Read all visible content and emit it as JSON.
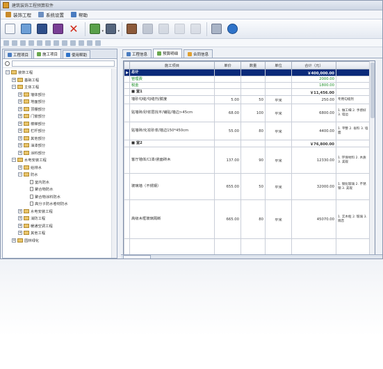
{
  "window": {
    "title": "建筑装饰工程预算软件",
    "icon_color": "#d99a2b"
  },
  "menu": [
    {
      "label": "装饰工程",
      "icon": "building-icon"
    },
    {
      "label": "系统设置",
      "icon": "settings-icon"
    },
    {
      "label": "帮助",
      "icon": "help-icon"
    }
  ],
  "toolbar": {
    "buttons": [
      {
        "name": "new-document-icon",
        "color": "#f4f6fa",
        "border": "#8894a8"
      },
      {
        "name": "open-folder-icon",
        "color": "#6d9fd6",
        "border": "#2f5e96"
      },
      {
        "name": "save-icon",
        "color": "#2f4f8a",
        "border": "#1b3260"
      },
      {
        "name": "save-as-icon",
        "color": "#7a3f95",
        "border": "#4c2260"
      },
      {
        "name": "delete-icon",
        "color": "#d12a1a",
        "border": "#8c1309"
      },
      {
        "name": "export-icon",
        "color": "#5aa04a",
        "border": "#356b28"
      },
      {
        "name": "print-icon",
        "color": "#55657d",
        "border": "#303c50"
      },
      {
        "name": "user-icon",
        "color": "#8c5a3a",
        "border": "#553520"
      },
      {
        "name": "settings-icon",
        "color": "#8a95a8",
        "border": "#55607a"
      },
      {
        "name": "calculator-icon",
        "color": "#b7bfcc",
        "border": "#7f8898"
      },
      {
        "name": "report-icon",
        "color": "#c9ced8",
        "border": "#8f97a6"
      },
      {
        "name": "table-icon",
        "color": "#c2c8d3",
        "border": "#888f9d"
      },
      {
        "name": "grid-icon",
        "color": "#a9b4c6",
        "border": "#6d7890"
      },
      {
        "name": "info-icon",
        "color": "#2f73c9",
        "border": "#1a4b8a"
      }
    ]
  },
  "left_panel": {
    "tabs": [
      {
        "label": "工程项目",
        "icon_color": "#4a7cc0"
      },
      {
        "label": "施工项目",
        "icon_color": "#6aa84f"
      },
      {
        "label": "使用帮助",
        "icon_color": "#2f73c9"
      }
    ],
    "search_placeholder": "",
    "tree": [
      {
        "label": "装饰工程",
        "level": 0,
        "type": "folder",
        "expander": "−"
      },
      {
        "label": "基础工程",
        "level": 1,
        "type": "folder",
        "expander": "+"
      },
      {
        "label": "主体工程",
        "level": 1,
        "type": "folder",
        "expander": "−"
      },
      {
        "label": "墙体部分",
        "level": 2,
        "type": "folder",
        "expander": "+"
      },
      {
        "label": "地面部分",
        "level": 2,
        "type": "folder",
        "expander": "+"
      },
      {
        "label": "顶棚部分",
        "level": 2,
        "type": "folder",
        "expander": "+"
      },
      {
        "label": "门窗部分",
        "level": 2,
        "type": "folder",
        "expander": "+"
      },
      {
        "label": "楼梯部分",
        "level": 2,
        "type": "folder",
        "expander": "+"
      },
      {
        "label": "栏杆部分",
        "level": 2,
        "type": "folder",
        "expander": "+"
      },
      {
        "label": "其他部分",
        "level": 2,
        "type": "folder",
        "expander": "+"
      },
      {
        "label": "油漆部分",
        "level": 2,
        "type": "folder",
        "expander": "+"
      },
      {
        "label": "涂料部分",
        "level": 2,
        "type": "folder",
        "expander": "+"
      },
      {
        "label": "水电安装工程",
        "level": 1,
        "type": "folder",
        "expander": "−"
      },
      {
        "label": "给排水",
        "level": 2,
        "type": "folder",
        "expander": "+"
      },
      {
        "label": "防水",
        "level": 2,
        "type": "folder",
        "expander": "−"
      },
      {
        "label": "室内防水",
        "level": 3,
        "type": "leaf",
        "expander": ""
      },
      {
        "label": "聚合物防水",
        "level": 3,
        "type": "leaf",
        "expander": ""
      },
      {
        "label": "聚合物涂料防水",
        "level": 3,
        "type": "leaf",
        "expander": ""
      },
      {
        "label": "高分子防水卷材防水",
        "level": 3,
        "type": "leaf",
        "expander": ""
      },
      {
        "label": "水电安装工程",
        "level": 2,
        "type": "folder",
        "expander": "+"
      },
      {
        "label": "消防工程",
        "level": 2,
        "type": "folder",
        "expander": "+"
      },
      {
        "label": "暖通空调工程",
        "level": 2,
        "type": "folder",
        "expander": "+"
      },
      {
        "label": "其他工程",
        "level": 2,
        "type": "folder",
        "expander": "+"
      },
      {
        "label": "园林绿化",
        "level": 1,
        "type": "folder",
        "expander": "+"
      }
    ]
  },
  "main_panel": {
    "tabs": [
      {
        "label": "工程信息",
        "icon_color": "#4a7cc0"
      },
      {
        "label": "预算明细",
        "icon_color": "#6aa84f"
      },
      {
        "label": "合同信息",
        "icon_color": "#e0a030"
      }
    ],
    "table": {
      "columns": [
        "",
        "施工项目",
        "单价",
        "数量",
        "单位",
        "合计（元）",
        ""
      ],
      "rows": [
        {
          "style": "sel",
          "h": 10,
          "cells": [
            "▶",
            "总计",
            "",
            "",
            "",
            "￥400,000.00",
            ""
          ]
        },
        {
          "style": "green",
          "h": 9,
          "cells": [
            "",
            "管理费",
            "",
            "",
            "",
            "2000.00",
            ""
          ]
        },
        {
          "style": "green",
          "h": 9,
          "cells": [
            "",
            "税金",
            "",
            "",
            "",
            "1800.00",
            ""
          ]
        },
        {
          "style": "sec",
          "h": 10,
          "cells": [
            "",
            "■ 室1",
            "",
            "",
            "",
            "￥11,456.00",
            ""
          ]
        },
        {
          "style": "",
          "h": 12,
          "cells": [
            "",
            "墙砂勾缝/勾缝剂/腻度",
            "5.00",
            "50",
            "平米",
            "250.00",
            "专用勾缝剂"
          ]
        },
        {
          "style": "",
          "h": 26,
          "cells": [
            "",
            "贴墙砖/砂浆层找平/铺贴/墙边>45cm",
            "68.00",
            "100",
            "平米",
            "6800.00",
            "1. 做工细 2. 手感好 3. 墙边"
          ]
        },
        {
          "style": "",
          "h": 26,
          "cells": [
            "",
            "贴墙砖/化妆砂浆/墙边150*450cm",
            "55.00",
            "80",
            "平米",
            "4400.00",
            "1. 平整 2. 省料 3. 墙面"
          ]
        },
        {
          "style": "sec",
          "h": 10,
          "cells": [
            "",
            "■ 室2",
            "",
            "",
            "",
            "￥76,800.00",
            ""
          ]
        },
        {
          "style": "",
          "h": 38,
          "cells": [
            "",
            "客厅墙体/口漆/瓷面砖木",
            "137.00",
            "90",
            "平米",
            "12330.00",
            "1. 环保材料 2. 木质 3. 美观"
          ]
        },
        {
          "style": "",
          "h": 38,
          "cells": [
            "",
            "玻璃墙（不锈钢）",
            "655.00",
            "50",
            "平米",
            "32000.00",
            "1. 钢化玻璃 2. 不锈钢 3. 美观"
          ]
        },
        {
          "style": "",
          "h": 56,
          "cells": [
            "",
            "高级木框玻璃隔断",
            "665.00",
            "80",
            "平米",
            "45070.00",
            "1. 实木框 2. 玻璃 3. 隔音"
          ]
        },
        {
          "style": "",
          "h": 40,
          "cells": [
            "",
            "",
            "",
            "",
            "",
            "",
            ""
          ]
        }
      ]
    }
  }
}
